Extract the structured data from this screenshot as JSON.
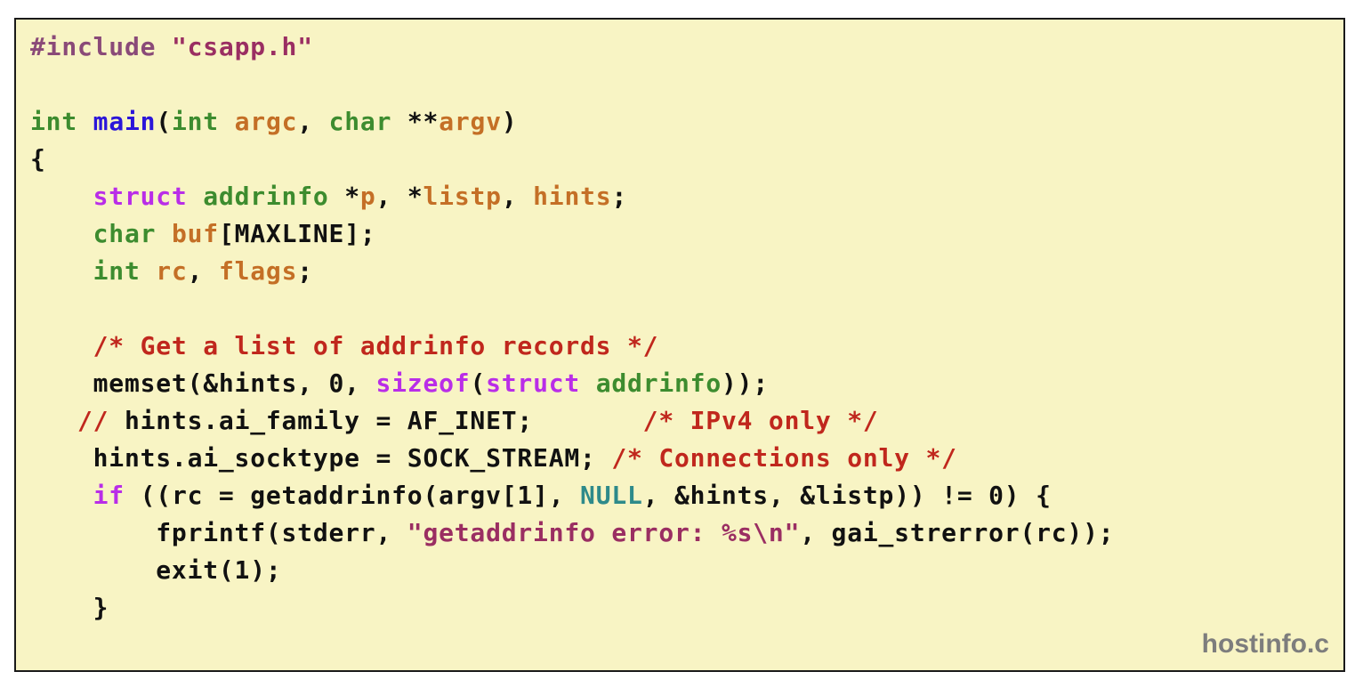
{
  "filename": "hostinfo.c",
  "code": {
    "l1_pp": "#include",
    "l1_str": "\"csapp.h\"",
    "l3_int": "int",
    "l3_main": "main",
    "l3_paren_open": "(",
    "l3_int2": "int",
    "l3_argc": "argc",
    "l3_comma": ", ",
    "l3_char": "char",
    "l3_stars": " **",
    "l3_argv": "argv",
    "l3_paren_close": ")",
    "l4_brace": "{",
    "l5_struct": "struct",
    "l5_addrinfo": "addrinfo",
    "l5_star1": " *",
    "l5_p": "p",
    "l5_sep1": ", *",
    "l5_listp": "listp",
    "l5_sep2": ", ",
    "l5_hints": "hints",
    "l5_semi": ";",
    "l6_char": "char",
    "l6_buf": "buf",
    "l6_rest": "[MAXLINE];",
    "l7_int": "int",
    "l7_rc": "rc",
    "l7_sep": ", ",
    "l7_flags": "flags",
    "l7_semi": ";",
    "l9_comment": "/* Get a list of addrinfo records */",
    "l10_a": "memset(&hints, 0, ",
    "l10_sizeof": "sizeof",
    "l10_paren": "(",
    "l10_struct": "struct",
    "l10_addrinfo": "addrinfo",
    "l10_b": "));",
    "l11_slashes": "//",
    "l11_code": " hints.ai_family = AF_INET;       ",
    "l11_comment": "/* IPv4 only */",
    "l12_code": "hints.ai_socktype = SOCK_STREAM; ",
    "l12_comment": "/* Connections only */",
    "l13_if": "if",
    "l13_a": " ((rc = getaddrinfo(argv[1], ",
    "l13_null": "NULL",
    "l13_b": ", &hints, &listp)) != 0) {",
    "l14_a": "fprintf(stderr, ",
    "l14_str": "\"getaddrinfo error: %s\\n\"",
    "l14_b": ", gai_strerror(rc));",
    "l15": "exit(1);",
    "l16": "}"
  }
}
